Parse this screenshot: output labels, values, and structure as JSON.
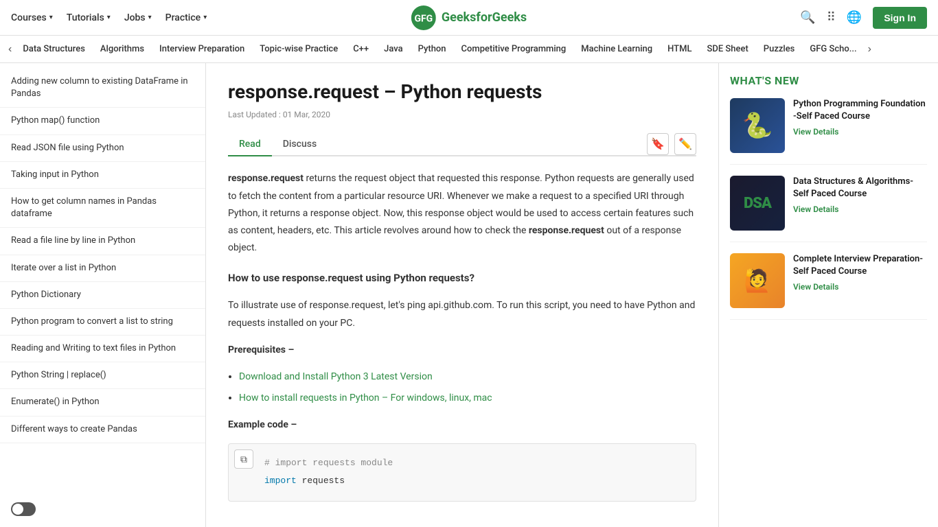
{
  "header": {
    "nav_items": [
      {
        "label": "Courses",
        "has_chevron": true
      },
      {
        "label": "Tutorials",
        "has_chevron": true
      },
      {
        "label": "Jobs",
        "has_chevron": true
      },
      {
        "label": "Practice",
        "has_chevron": true
      }
    ],
    "logo_text": "GeeksforGeeks",
    "sign_in_label": "Sign In"
  },
  "sub_nav": {
    "items": [
      "Data Structures",
      "Algorithms",
      "Interview Preparation",
      "Topic-wise Practice",
      "C++",
      "Java",
      "Python",
      "Competitive Programming",
      "Machine Learning",
      "HTML",
      "SDE Sheet",
      "Puzzles",
      "GFG Scho..."
    ]
  },
  "sidebar": {
    "items": [
      "Adding new column to existing DataFrame in Pandas",
      "Python map() function",
      "Read JSON file using Python",
      "Taking input in Python",
      "How to get column names in Pandas dataframe",
      "Read a file line by line in Python",
      "Iterate over a list in Python",
      "Python Dictionary",
      "Python program to convert a list to string",
      "Reading and Writing to text files in Python",
      "Python String | replace()",
      "Enumerate() in Python",
      "Different ways to create Pandas"
    ]
  },
  "article": {
    "title": "response.request – Python requests",
    "last_updated": "Last Updated : 01 Mar, 2020",
    "tabs": [
      "Read",
      "Discuss"
    ],
    "body": {
      "intro_bold": "response.request",
      "intro_text": " returns the request object that requested this response. Python requests are generally used to fetch the content from a particular resource URI. Whenever we make a request to a specified URI through Python, it returns a response object. Now, this response object would be used to access certain features such as content, headers, etc. This article revolves around how to check the ",
      "intro_bold2": "response.request",
      "intro_end": " out of a response object.",
      "section_heading": "How to use response.request using Python requests?",
      "section_text": "To illustrate use of response.request, let's ping api.github.com. To run this script, you need to have Python and requests installed on your PC.",
      "prerequisites_label": "Prerequisites –",
      "prerequisites": [
        {
          "text": "Download and Install Python 3 Latest Version",
          "url": "#"
        },
        {
          "text": "How to install requests in Python – For windows, linux, mac",
          "url": "#"
        }
      ],
      "example_label": "Example code –",
      "code": [
        "# import requests module",
        "import requests"
      ]
    }
  },
  "whats_new": {
    "title": "WHAT'S NEW",
    "courses": [
      {
        "id": "python",
        "title": "Python Programming Foundation -Self Paced Course",
        "view_details": "View Details",
        "thumb_type": "python"
      },
      {
        "id": "dsa",
        "title": "Data Structures & Algorithms- Self Paced Course",
        "view_details": "View Details",
        "thumb_type": "dsa"
      },
      {
        "id": "interview",
        "title": "Complete Interview Preparation- Self Paced Course",
        "view_details": "View Details",
        "thumb_type": "interview"
      }
    ]
  }
}
